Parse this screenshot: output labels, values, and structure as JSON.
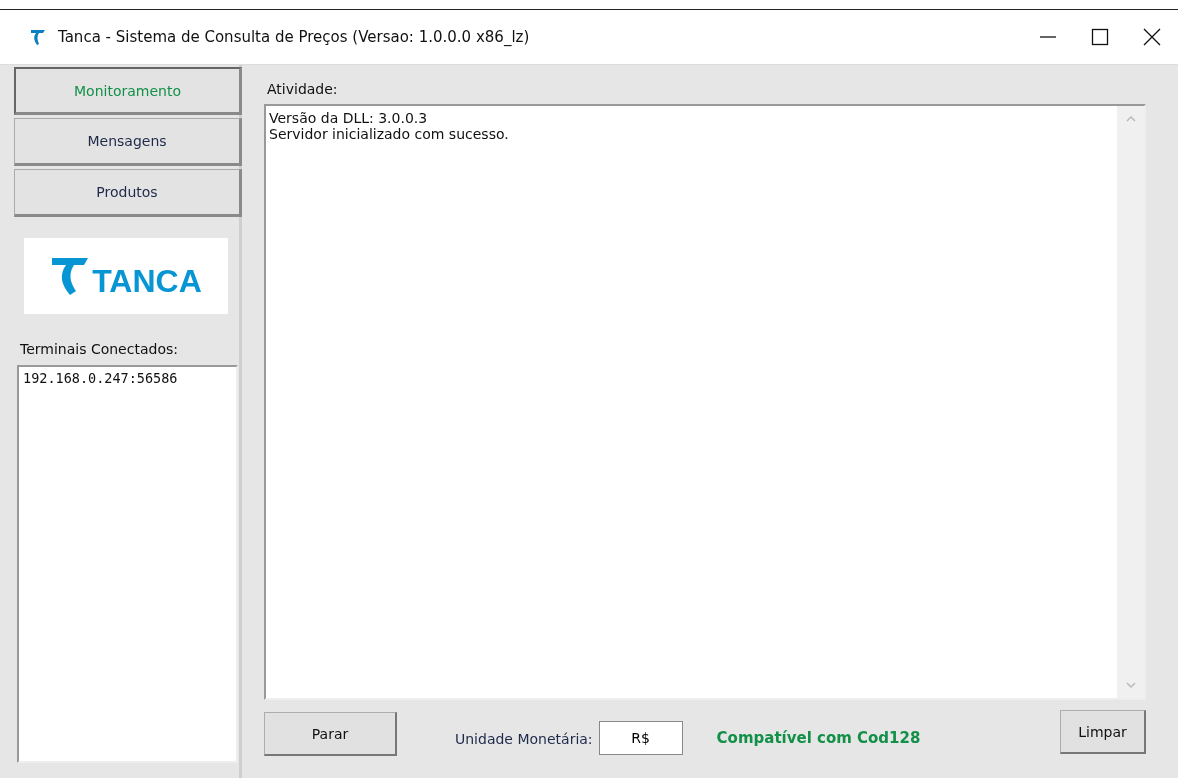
{
  "window": {
    "title": "Tanca - Sistema de Consulta de  Preços (Versao: 1.0.0.0 x86_lz)"
  },
  "tabs": [
    {
      "label": "Monitoramento",
      "selected": true
    },
    {
      "label": "Mensagens",
      "selected": false
    },
    {
      "label": "Produtos",
      "selected": false
    }
  ],
  "logo": {
    "text": "TANCA"
  },
  "terminals": {
    "label": "Terminais Conectados:",
    "items": [
      "192.168.0.247:56586"
    ]
  },
  "activity": {
    "label": "Atividade:",
    "lines": [
      "Versão da DLL: 3.0.0.3",
      "Servidor inicializado com sucesso."
    ]
  },
  "bottom": {
    "stop_button": "Parar",
    "currency_label": "Unidade Monetária:",
    "currency_value": "R$",
    "status": "Compatível com Cod128",
    "clear_button": "Limpar"
  }
}
